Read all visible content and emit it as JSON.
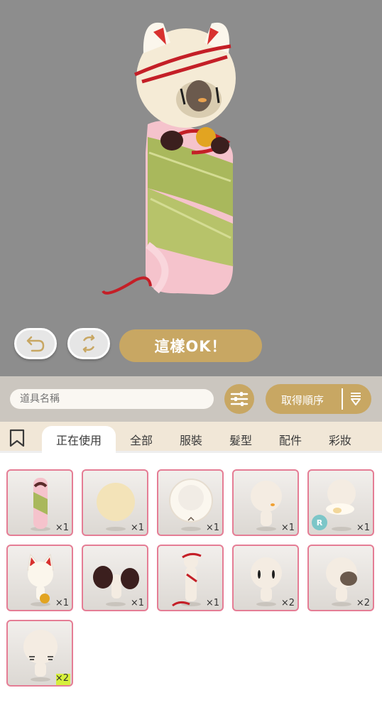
{
  "controls": {
    "undo_icon": "undo-arrow-icon",
    "randomize_icon": "refresh-cycle-icon",
    "ok_label": "這樣OK！"
  },
  "search": {
    "placeholder": "道具名稱",
    "filter_icon": "sliders-icon",
    "order_label": "取得順序",
    "order_icon": "sort-down-icon"
  },
  "tabs": {
    "bookmark_icon": "bookmark-icon",
    "items": [
      {
        "label": "正在使用",
        "active": true
      },
      {
        "label": "全部"
      },
      {
        "label": "服裝"
      },
      {
        "label": "髮型"
      },
      {
        "label": "配件"
      },
      {
        "label": "彩妝"
      }
    ]
  },
  "inventory": [
    {
      "name": "sakura-mochi-outfit",
      "count": "×1"
    },
    {
      "name": "round-cream-back-item",
      "count": "×1"
    },
    {
      "name": "cream-curly-hair",
      "count": "×1"
    },
    {
      "name": "orange-mouth-makeup",
      "count": "×1"
    },
    {
      "name": "cream-fluff-accessory",
      "count": "×1",
      "badge": "R"
    },
    {
      "name": "cat-ears-bell",
      "count": "×1"
    },
    {
      "name": "dark-fur-muff",
      "count": "×1"
    },
    {
      "name": "red-string-accessory",
      "count": "×1"
    },
    {
      "name": "black-eyes",
      "count": "×2"
    },
    {
      "name": "dark-nose-patch",
      "count": "×2"
    },
    {
      "name": "closed-eyes",
      "count": "×2"
    }
  ],
  "colors": {
    "stage": "#8d8d8d",
    "accent_gold": "#c8a763",
    "tab_bar": "#f1e7d7",
    "item_border": "#e57d95",
    "leaf_green": "#a9b85c",
    "mochi_pink": "#f5c3cc",
    "string_red": "#c41f27"
  }
}
